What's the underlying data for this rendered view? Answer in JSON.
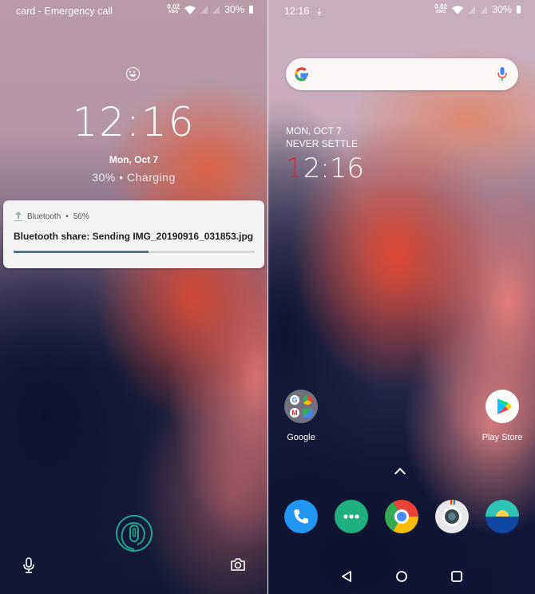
{
  "lock_screen": {
    "status_bar": {
      "carrier_text": "card - Emergency call",
      "net_speed_value": "0.02",
      "net_speed_unit": "KB/S",
      "battery": "30%"
    },
    "clock": "12:16",
    "date": "Mon, Oct 7",
    "charging": "30% • Charging",
    "notification": {
      "app": "Bluetooth",
      "separator": "•",
      "percent": "56%",
      "progress": 0.56,
      "title": "Bluetooth share: Sending IMG_20190916_031853.jpg",
      "progress_color": "#5a7580"
    },
    "icons": {
      "top": "smiley-icon",
      "bottom_left": "mic-icon",
      "bottom_center": "fingerprint-icon",
      "bottom_right": "camera-icon"
    }
  },
  "home_screen": {
    "status_bar": {
      "time": "12:16",
      "net_speed_value": "0.02",
      "net_speed_unit": "KB/S",
      "battery": "30%"
    },
    "search_bar": {
      "logo": "G"
    },
    "widget": {
      "date": "MON, OCT 7",
      "tagline": "NEVER SETTLE",
      "time_first": "1",
      "time_rest": "2:16",
      "accent": "#e2252a"
    },
    "apps": [
      {
        "label": "Google"
      },
      {
        "label": "Play Store"
      }
    ],
    "dock": [
      {
        "name": "phone",
        "color": "#2196f3"
      },
      {
        "name": "messages",
        "color": "#20b080"
      },
      {
        "name": "chrome"
      },
      {
        "name": "camera"
      },
      {
        "name": "weather"
      }
    ],
    "nav": [
      "back",
      "home",
      "recents"
    ]
  }
}
